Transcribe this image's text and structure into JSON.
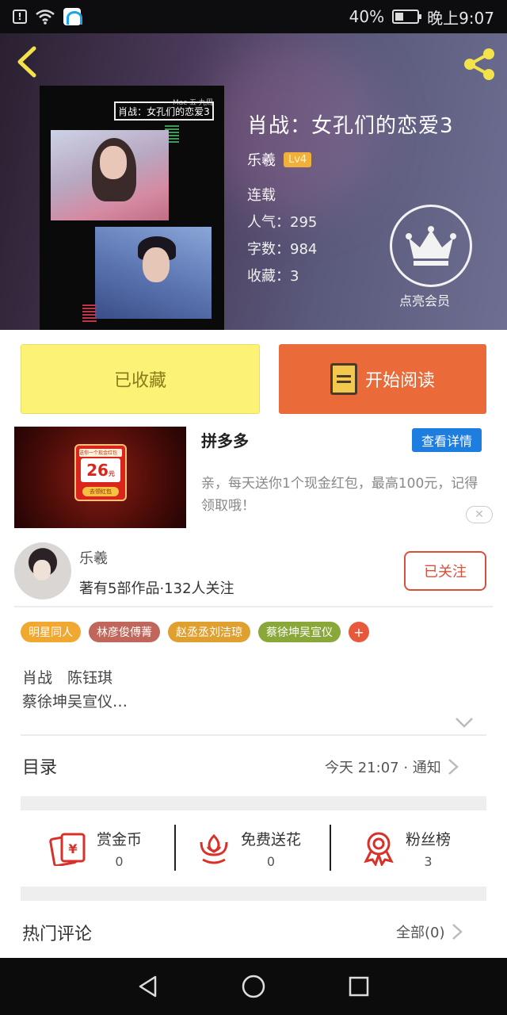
{
  "status_bar": {
    "battery_percent": "40%",
    "time": "晚上9:07",
    "battery_level": 0.4
  },
  "book": {
    "title": "肖战：女孔们的恋爱3",
    "cover_title": "肖战：女孔们的恋爱3",
    "cover_small_text": "Mac 五 九周",
    "author": "乐羲",
    "level": "Lv4",
    "status": "连载",
    "popularity": "人气：295",
    "word_count": "字数：984",
    "favorites": "收藏：3",
    "vip_label": "点亮会员"
  },
  "actions": {
    "collected_label": "已收藏",
    "read_label": "开始阅读"
  },
  "ad": {
    "title": "拼多多",
    "detail_button": "查看详情",
    "description": "亲，每天送你1个现金红包，最高100元，记得领取哦！",
    "card_top": "送你一个现金红包",
    "amount": "26",
    "unit": "元",
    "card_button": "去领红包",
    "close_icon": "close-icon"
  },
  "author_section": {
    "name": "乐羲",
    "info": "著有5部作品·132人关注",
    "follow_label": "已关注"
  },
  "tags": [
    {
      "label": "明星同人",
      "color": "#f0a830"
    },
    {
      "label": "林彦俊傅菁",
      "color": "#c0665a"
    },
    {
      "label": "赵丞丞刘洁琼",
      "color": "#e0a030"
    },
    {
      "label": "蔡徐坤吴宣仪",
      "color": "#8aa83a"
    }
  ],
  "tag_more": "+",
  "synopsis": {
    "line1": "肖战　陈钰琪",
    "line2": "蔡徐坤吴宣仪…"
  },
  "catalog": {
    "title": "目录",
    "update": "今天 21:07 · 通知"
  },
  "stats": [
    {
      "label": "赏金币",
      "count": "0",
      "icon": "red-envelope-icon"
    },
    {
      "label": "免费送花",
      "count": "0",
      "icon": "flower-icon"
    },
    {
      "label": "粉丝榜",
      "count": "3",
      "icon": "medal-icon"
    }
  ],
  "comments": {
    "title": "热门评论",
    "all": "全部(0)"
  },
  "colors": {
    "accent_yellow": "#fbf276",
    "accent_orange": "#ea6a3a",
    "follow_red": "#d9503a",
    "link_blue": "#1e7ee0"
  }
}
